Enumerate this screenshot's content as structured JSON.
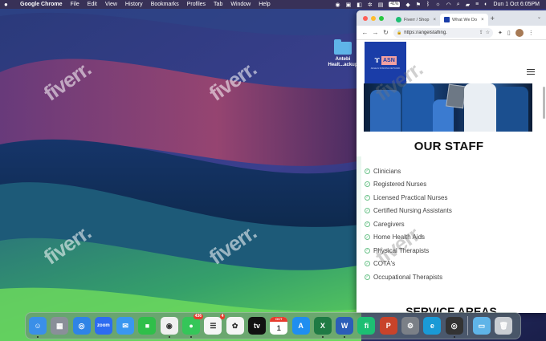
{
  "menubar": {
    "app_name": "Google Chrome",
    "items": [
      "File",
      "Edit",
      "View",
      "History",
      "Bookmarks",
      "Profiles",
      "Tab",
      "Window",
      "Help"
    ],
    "battery_text": "41%",
    "datetime": "Dun 1 Oct 6:05PM"
  },
  "desktop": {
    "folder_label_line1": "Antebi",
    "folder_label_line2": "Healt...ackup"
  },
  "watermark_text": "fiverr.",
  "browser": {
    "tabs": [
      {
        "title": "Fiverr / Shop",
        "favicon_color": "#1dbf73",
        "active": false
      },
      {
        "title": "What We Do",
        "favicon_color": "#1a3da8",
        "active": true
      }
    ],
    "new_tab_symbol": "+",
    "url": "https://angelstaffing.",
    "back_symbol": "←",
    "forward_symbol": "→",
    "reload_symbol": "↻"
  },
  "site": {
    "logo_abbr": "ASN",
    "logo_tagline": "ANGELS STAFFING NETWORK",
    "staff_heading": "OUR STAFF",
    "staff_items": [
      "Clinicians",
      "Registered Nurses",
      "Licensed Practical Nurses",
      "Certified Nursing Assistants",
      "Caregivers",
      "Home Health Aids",
      "Physical Therapists",
      "COTA's",
      "Occupational Therapists"
    ],
    "next_heading": "SERVICE AREAS"
  },
  "dock": {
    "apps": [
      {
        "name": "finder",
        "color": "#3a8fe8",
        "glyph": "☺"
      },
      {
        "name": "launchpad",
        "color": "#8a8f99",
        "glyph": "▦"
      },
      {
        "name": "safari",
        "color": "#2f84e6",
        "glyph": "◎"
      },
      {
        "name": "zoom",
        "color": "#2d6cf0",
        "glyph": "zoom"
      },
      {
        "name": "mail",
        "color": "#3a97f0",
        "glyph": "✉"
      },
      {
        "name": "facetime",
        "color": "#2fbf4a",
        "glyph": "■"
      },
      {
        "name": "chrome",
        "color": "#f0f0f0",
        "glyph": "◉"
      },
      {
        "name": "messages",
        "color": "#35c659",
        "glyph": "●",
        "badge": "436"
      },
      {
        "name": "reminders",
        "color": "#f5f5f5",
        "glyph": "☰",
        "badge": "4"
      },
      {
        "name": "photos",
        "color": "#f5f5f5",
        "glyph": "✿"
      },
      {
        "name": "apple-tv",
        "color": "#111111",
        "glyph": "tv"
      },
      {
        "name": "calendar",
        "color": "#ffffff",
        "glyph": "1",
        "month": "OCT"
      },
      {
        "name": "app-store",
        "color": "#1f8ef0",
        "glyph": "A"
      },
      {
        "name": "excel",
        "color": "#1f7a44",
        "glyph": "X"
      },
      {
        "name": "word",
        "color": "#2b5eb8",
        "glyph": "W"
      },
      {
        "name": "fiverr",
        "color": "#1dbf73",
        "glyph": "fi"
      },
      {
        "name": "powerpoint",
        "color": "#c8432a",
        "glyph": "P"
      },
      {
        "name": "system-settings",
        "color": "#7b8087",
        "glyph": "⚙"
      },
      {
        "name": "edge",
        "color": "#1a9ad6",
        "glyph": "e"
      },
      {
        "name": "screenshot",
        "color": "#333333",
        "glyph": "◎"
      }
    ],
    "downloads": {
      "name": "downloads",
      "color": "#5fb4e8",
      "glyph": "▭"
    },
    "trash": {
      "name": "trash",
      "color": "#c9cdd2",
      "glyph": "🗑"
    }
  }
}
